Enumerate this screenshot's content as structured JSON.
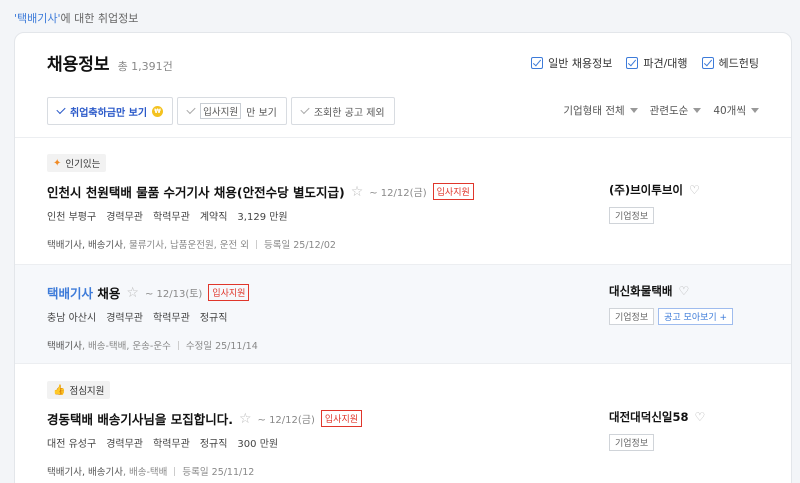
{
  "top_note": {
    "keyword": "'택배기사'",
    "suffix": "에 대한 취업정보"
  },
  "header": {
    "title": "채용정보",
    "count": "총 1,391건"
  },
  "type_checks": [
    "일반 채용정보",
    "파견/대행",
    "헤드헌팅"
  ],
  "filters": {
    "celebration": "취업축하금만 보기",
    "coin": "₩",
    "direct_apply_boxed": "입사지원",
    "direct_apply_suffix": "만 보기",
    "exclude_viewed": "조회한 공고 제외"
  },
  "sorts": [
    "기업형태 전체",
    "관련도순",
    "40개씩"
  ],
  "jobs": [
    {
      "badge_icon": "✦",
      "badge": "인기있는",
      "title": "인천시 천원택배 물품 수거기사 채용(안전수당 별도지급)",
      "keyword": "",
      "deadline": "~ 12/12(금)",
      "apply": "입사지원",
      "meta": [
        "인천 부평구",
        "경력무관",
        "학력무관",
        "계약직",
        "3,129 만원"
      ],
      "tags_bold": "택배기사, 배송기사",
      "tags_rest": ", 물류기사, 납품운전원, 운전 외",
      "date": "등록일 25/12/02",
      "company": "(주)브이투브이",
      "company_info": "기업정보",
      "company_more": ""
    },
    {
      "badge_icon": "",
      "badge": "",
      "keyword": "택배기사",
      "title": " 채용",
      "deadline": "~ 12/13(토)",
      "apply": "입사지원",
      "meta": [
        "충남 아산시",
        "경력무관",
        "학력무관",
        "정규직"
      ],
      "tags_bold": "택배기사",
      "tags_rest": ", 배송-택배, 운송-운수",
      "date": "수정일 25/11/14",
      "company": "대신화물택배",
      "company_info": "기업정보",
      "company_more": "공고 모아보기 +"
    },
    {
      "badge_icon": "👍",
      "badge": "점심지원",
      "keyword": "",
      "title": "경동택배 배송기사님을 모집합니다.",
      "deadline": "~ 12/12(금)",
      "apply": "입사지원",
      "meta": [
        "대전 유성구",
        "경력무관",
        "학력무관",
        "정규직",
        "300 만원"
      ],
      "tags_bold": "택배기사, 배송기사",
      "tags_rest": ", 배송-택배",
      "date": "등록일 25/11/12",
      "company": "대전대덕신일58",
      "company_info": "기업정보",
      "company_more": ""
    }
  ]
}
